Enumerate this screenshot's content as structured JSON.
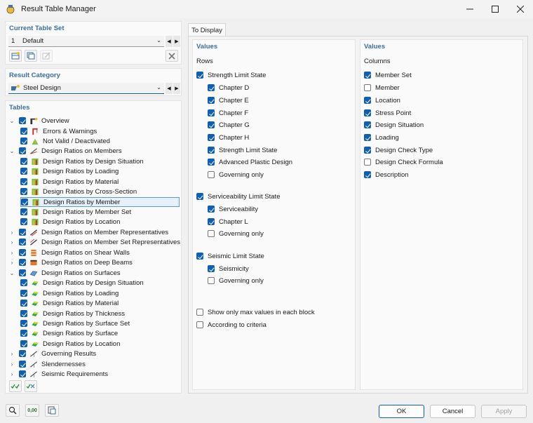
{
  "window": {
    "title": "Result Table Manager"
  },
  "current_table_set": {
    "label": "Current Table Set",
    "number": "1",
    "value": "Default"
  },
  "result_category": {
    "label": "Result Category",
    "value": "Steel Design"
  },
  "tables": {
    "label": "Tables",
    "items": [
      {
        "label": "Overview",
        "expander": "v",
        "checked": true,
        "icon": "overview-icon"
      },
      {
        "label": "Errors & Warnings",
        "expander": "",
        "checked": true,
        "icon": "errors-warnings-icon"
      },
      {
        "label": "Not Valid / Deactivated",
        "expander": "",
        "checked": true,
        "icon": "not-valid-icon"
      },
      {
        "label": "Design Ratios on Members",
        "expander": "v",
        "checked": true,
        "icon": "member-icon"
      },
      {
        "label": "Design Ratios by Design Situation",
        "expander": "",
        "checked": true,
        "icon": "ratio-member-icon"
      },
      {
        "label": "Design Ratios by Loading",
        "expander": "",
        "checked": true,
        "icon": "ratio-member-icon"
      },
      {
        "label": "Design Ratios by Material",
        "expander": "",
        "checked": true,
        "icon": "ratio-member-icon"
      },
      {
        "label": "Design Ratios by Cross-Section",
        "expander": "",
        "checked": true,
        "icon": "ratio-member-icon"
      },
      {
        "label": "Design Ratios by Member",
        "expander": "",
        "checked": true,
        "icon": "ratio-member-icon"
      },
      {
        "label": "Design Ratios by Member Set",
        "expander": "",
        "checked": true,
        "icon": "ratio-member-icon"
      },
      {
        "label": "Design Ratios by Location",
        "expander": "",
        "checked": true,
        "icon": "ratio-member-icon"
      },
      {
        "label": "Design Ratios on Member Representatives",
        "expander": ">",
        "checked": true,
        "icon": "member-rep-icon"
      },
      {
        "label": "Design Ratios on Member Set Representatives",
        "expander": ">",
        "checked": true,
        "icon": "member-set-rep-icon"
      },
      {
        "label": "Design Ratios on Shear Walls",
        "expander": ">",
        "checked": true,
        "icon": "shear-wall-icon"
      },
      {
        "label": "Design Ratios on Deep Beams",
        "expander": ">",
        "checked": true,
        "icon": "deep-beam-icon"
      },
      {
        "label": "Design Ratios on Surfaces",
        "expander": "v",
        "checked": true,
        "icon": "surface-icon"
      },
      {
        "label": "Design Ratios by Design Situation",
        "expander": "",
        "checked": true,
        "icon": "ratio-surface-icon"
      },
      {
        "label": "Design Ratios by Loading",
        "expander": "",
        "checked": true,
        "icon": "ratio-surface-icon"
      },
      {
        "label": "Design Ratios by Material",
        "expander": "",
        "checked": true,
        "icon": "ratio-surface-icon"
      },
      {
        "label": "Design Ratios by Thickness",
        "expander": "",
        "checked": true,
        "icon": "ratio-surface-icon"
      },
      {
        "label": "Design Ratios by Surface Set",
        "expander": "",
        "checked": true,
        "icon": "ratio-surface-icon"
      },
      {
        "label": "Design Ratios by Surface",
        "expander": "",
        "checked": true,
        "icon": "ratio-surface-icon"
      },
      {
        "label": "Design Ratios by Location",
        "expander": "",
        "checked": true,
        "icon": "ratio-surface-icon"
      },
      {
        "label": "Governing Results",
        "expander": ">",
        "checked": true,
        "icon": "governing-icon"
      },
      {
        "label": "Slendernesses",
        "expander": ">",
        "checked": true,
        "icon": "slenderness-icon"
      },
      {
        "label": "Seismic Requirements",
        "expander": ">",
        "checked": true,
        "icon": "seismic-icon"
      }
    ],
    "selected_index": 8
  },
  "tab": {
    "label": "To Display"
  },
  "rows_panel": {
    "heading": "Values",
    "subheading": "Rows",
    "options": [
      {
        "label": "Strength Limit State",
        "checked": true
      },
      {
        "label": "Chapter D",
        "checked": true
      },
      {
        "label": "Chapter E",
        "checked": true
      },
      {
        "label": "Chapter F",
        "checked": true
      },
      {
        "label": "Chapter G",
        "checked": true
      },
      {
        "label": "Chapter H",
        "checked": true
      },
      {
        "label": "Strength Limit State",
        "checked": true
      },
      {
        "label": "Advanced Plastic Design",
        "checked": true
      },
      {
        "label": "Governing only",
        "checked": false
      },
      {
        "label": "Serviceability Limit State",
        "checked": true
      },
      {
        "label": "Serviceability",
        "checked": true
      },
      {
        "label": "Chapter L",
        "checked": true
      },
      {
        "label": "Governing only",
        "checked": false
      },
      {
        "label": "Seismic Limit State",
        "checked": true
      },
      {
        "label": "Seismicity",
        "checked": true
      },
      {
        "label": "Governing only",
        "checked": false
      },
      {
        "label": "Show only max values in each block",
        "checked": false
      },
      {
        "label": "According to criteria",
        "checked": false
      }
    ]
  },
  "columns_panel": {
    "heading": "Values",
    "subheading": "Columns",
    "options": [
      {
        "label": "Member Set",
        "checked": true
      },
      {
        "label": "Member",
        "checked": false
      },
      {
        "label": "Location",
        "checked": true
      },
      {
        "label": "Stress Point",
        "checked": true
      },
      {
        "label": "Design Situation",
        "checked": true
      },
      {
        "label": "Loading",
        "checked": true
      },
      {
        "label": "Design Check Type",
        "checked": true
      },
      {
        "label": "Design Check Formula",
        "checked": false
      },
      {
        "label": "Description",
        "checked": true
      }
    ]
  },
  "footer": {
    "ok_label": "OK",
    "cancel_label": "Cancel",
    "apply_label": "Apply",
    "units_label": "0,00"
  },
  "colors": {
    "accent": "#0f5fb5",
    "section_label": "#3a6ea5"
  }
}
